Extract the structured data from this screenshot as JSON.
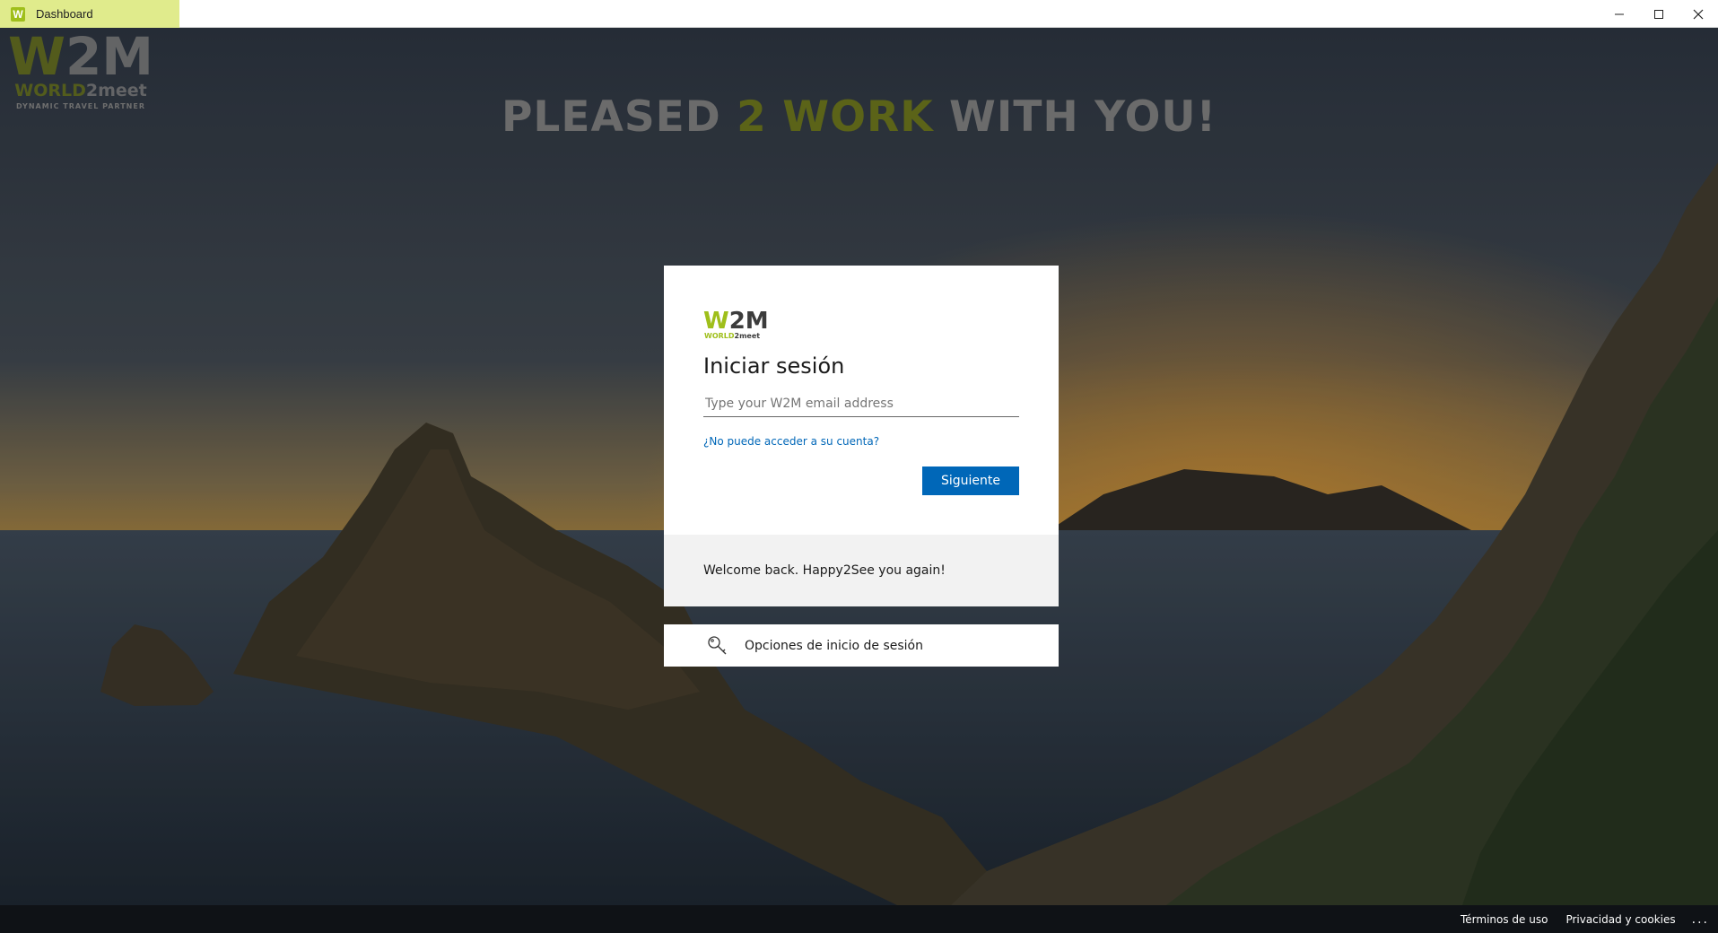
{
  "window": {
    "title": "Dashboard",
    "app_icon_letter": "W",
    "controls": {
      "minimize": "minimize-icon",
      "maximize": "maximize-icon",
      "close": "close-icon"
    }
  },
  "headline": {
    "part1": "PLEASED ",
    "part2": "2 WORK",
    "part3": " WITH YOU!"
  },
  "login": {
    "logo_text": "W2M",
    "logo_subtext": "WORLD2meet",
    "title": "Iniciar sesión",
    "email_placeholder": "Type your W2M email address",
    "email_value": "",
    "cant_access_link": "¿No puede acceder a su cuenta?",
    "next_button": "Siguiente",
    "footer_message": "Welcome back. Happy2See you again!"
  },
  "signin_options": {
    "icon": "key-search-icon",
    "label": "Opciones de inicio de sesión"
  },
  "brand_watermark": {
    "logo": "W2M",
    "name": "WORLD2meet",
    "tagline": "DYNAMIC TRAVEL PARTNER"
  },
  "footer": {
    "terms": "Términos de uso",
    "privacy": "Privacidad y cookies",
    "more": "..."
  },
  "colors": {
    "accent_blue": "#0067b8",
    "brand_green": "#9fbf1b",
    "title_tab": "#e0eb8c"
  }
}
